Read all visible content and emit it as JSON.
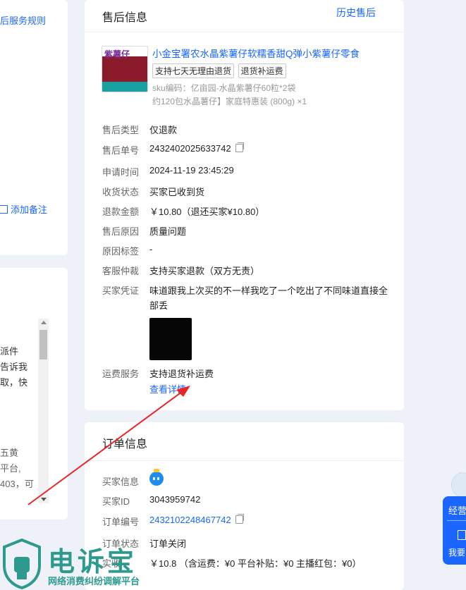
{
  "left": {
    "rules_link": "后服务规则",
    "add_note": "添加备注",
    "text_lines": [
      "派件",
      "告诉我",
      "取，快"
    ],
    "text_lines2": [
      "五黄",
      "平台,",
      "403，可"
    ]
  },
  "after_sale": {
    "title": "售后信息",
    "history_link": "历史售后",
    "product": {
      "title": "小金宝署农水晶紫薯仔软糯香甜Q弹小紫薯仔零食",
      "thumb_text": "紫薯仔",
      "tags": [
        "支持七天无理由退货",
        "退货补运费"
      ],
      "sku_line1": "sku编码：亿亩园-水晶紫薯仔60粒*2袋",
      "sku_line2": "约120包水晶薯仔】家庭特惠装 (800g) ×1"
    },
    "fields": [
      {
        "label": "售后类型",
        "value": "仅退款"
      },
      {
        "label": "售后单号",
        "value": "2432402025633742"
      },
      {
        "label": "申请时间",
        "value": "2024-11-19 23:45:29"
      },
      {
        "label": "收货状态",
        "value": "买家已收到货"
      },
      {
        "label": "退款金额",
        "value": "￥10.80（退还买家¥10.80）"
      },
      {
        "label": "售后原因",
        "value": "质量问题"
      },
      {
        "label": "原因标签",
        "value": "-"
      },
      {
        "label": "客服仲裁",
        "value": "支持买家退款（双方无责）"
      },
      {
        "label": "买家凭证",
        "value": "味道跟我上次买的不一样我吃了一个吃出了不同味道直接全部丢"
      }
    ],
    "shipping": {
      "label": "运费服务",
      "value": "支持退货补运费",
      "link": "查看详情"
    }
  },
  "order": {
    "title": "订单信息",
    "fields": [
      {
        "label": "买家信息",
        "value": ""
      },
      {
        "label": "买家ID",
        "value": "3043959742"
      },
      {
        "label": "订单编号",
        "value": "2432102248467742"
      },
      {
        "label": "订单状态",
        "value": "订单关闭"
      },
      {
        "label": "实收",
        "value": "￥10.8  （含运费：¥0 平台补贴：¥0 主播红包：¥0）"
      }
    ]
  },
  "right_widget": {
    "label1": "经营",
    "label2": "我要"
  },
  "watermark": {
    "title": "电诉宝",
    "subtitle": "网络消费纠纷调解平台"
  },
  "colors": {
    "accent": "#1a66ff",
    "arrow": "#e8262a"
  }
}
